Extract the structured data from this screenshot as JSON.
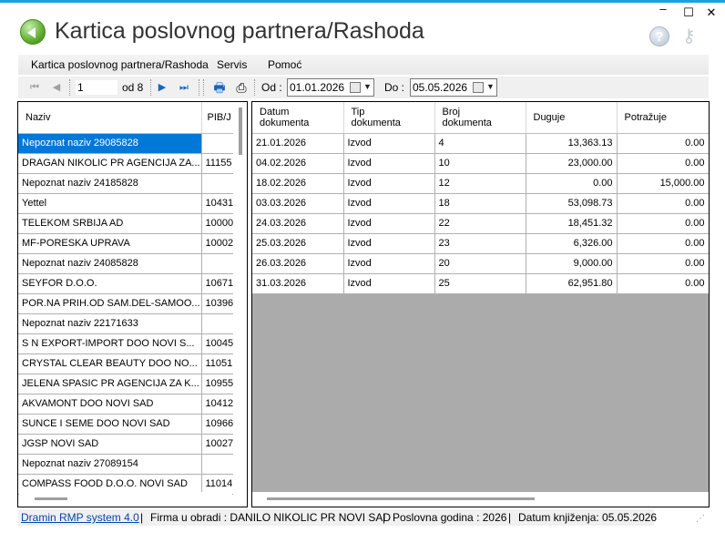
{
  "window": {
    "title": "Kartica poslovnog partnera/Rashoda",
    "min_glyph": "–",
    "max_glyph": "☐",
    "close_glyph": "✕",
    "accent": "#1ba1e2"
  },
  "icons": {
    "logo": "back-arrow-icon",
    "help": "help-icon",
    "keys": "keys-icon",
    "help_glyph": "?",
    "keys_glyph": "⚷"
  },
  "menu": [
    "Kartica poslovnog partnera/Rashoda",
    "Servis",
    "Pomoć"
  ],
  "toolbar": {
    "position_value": "1",
    "of_label": "od 8",
    "from_label": "Od :",
    "from_date": "01.01.2026",
    "to_label": "Do :",
    "to_date": "05.05.2026",
    "first_glyph": "⏮",
    "prev_glyph": "◀",
    "next_glyph": "▶",
    "last_glyph": "⏭",
    "print_glyph": "🖶",
    "preview_glyph": "⎙",
    "dropdown_glyph": "▼"
  },
  "partners": {
    "columns": [
      "Naziv",
      "PIB/J"
    ],
    "selected_index": 0,
    "rows": [
      [
        "Nepoznat naziv 29085828",
        ""
      ],
      [
        "DRAGAN NIKOLIC PR AGENCIJA ZA...",
        "11155"
      ],
      [
        "Nepoznat naziv 24185828",
        ""
      ],
      [
        "Yettel",
        "10431"
      ],
      [
        "TELEKOM SRBIJA AD",
        "10000"
      ],
      [
        "MF-PORESKA UPRAVA",
        "10002"
      ],
      [
        "Nepoznat naziv 24085828",
        ""
      ],
      [
        "SEYFOR D.O.O.",
        "10671"
      ],
      [
        "POR.NA PRIH.OD SAM.DEL-SAMOO...",
        "10396"
      ],
      [
        "Nepoznat naziv 22171633",
        ""
      ],
      [
        "S  N EXPORT-IMPORT DOO NOVI S...",
        "10045"
      ],
      [
        "CRYSTAL CLEAR BEAUTY DOO NO...",
        "11051"
      ],
      [
        "JELENA SPASIC PR AGENCIJA ZA K...",
        "10955"
      ],
      [
        "AKVAMONT DOO NOVI SAD",
        "10412"
      ],
      [
        "SUNCE I SEME DOO NOVI SAD",
        "10966"
      ],
      [
        "JGSP NOVI SAD",
        "10027"
      ],
      [
        "Nepoznat naziv 27089154",
        ""
      ],
      [
        "COMPASS FOOD D.O.O. NOVI SAD",
        "11014"
      ]
    ]
  },
  "documents": {
    "columns": [
      "Datum\ndokumenta",
      "Tip\ndokumenta",
      "Broj\ndokumenta",
      "Duguje",
      "Potražuje"
    ],
    "rows": [
      [
        "21.01.2026",
        "Izvod",
        "4",
        "13,363.13",
        "0.00"
      ],
      [
        "04.02.2026",
        "Izvod",
        "10",
        "23,000.00",
        "0.00"
      ],
      [
        "18.02.2026",
        "Izvod",
        "12",
        "0.00",
        "15,000.00"
      ],
      [
        "03.03.2026",
        "Izvod",
        "18",
        "53,098.73",
        "0.00"
      ],
      [
        "24.03.2026",
        "Izvod",
        "22",
        "18,451.32",
        "0.00"
      ],
      [
        "25.03.2026",
        "Izvod",
        "23",
        "6,326.00",
        "0.00"
      ],
      [
        "26.03.2026",
        "Izvod",
        "20",
        "9,000.00",
        "0.00"
      ],
      [
        "31.03.2026",
        "Izvod",
        "25",
        "62,951.80",
        "0.00"
      ]
    ]
  },
  "status": {
    "app_link": "Dramin RMP system 4.0",
    "sep": "|",
    "company": "Firma u obradi : DANILO NIKOLIC PR NOVI SAD",
    "year": "Poslovna godina : 2026",
    "booking_date": "Datum knjiženja: 05.05.2026",
    "grip_glyph": "⋰"
  }
}
